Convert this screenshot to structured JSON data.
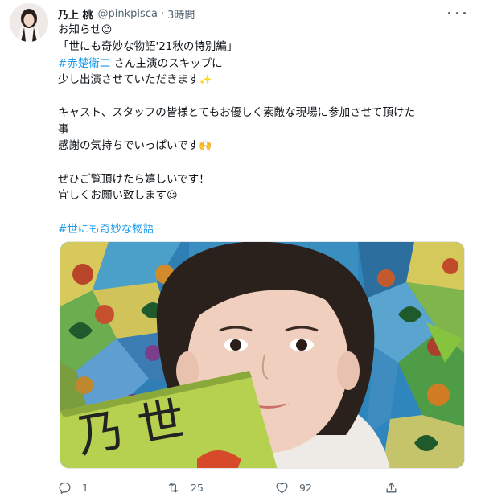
{
  "user": {
    "display_name": "乃上 桃",
    "handle": "@pinkpisca",
    "separator": "·",
    "time": "3時間"
  },
  "tweet": {
    "lines": [
      [
        {
          "t": "お知らせ"
        },
        {
          "e": "☺"
        }
      ],
      [
        {
          "t": "「世にも奇妙な物語'21秋の特別編」"
        }
      ],
      [
        {
          "l": "#赤楚衛二"
        },
        {
          "t": " さん主演のスキップに"
        }
      ],
      [
        {
          "t": "少し出演させていただきます"
        },
        {
          "e": "✨"
        }
      ],
      [],
      [
        {
          "t": "キャスト、スタッフの皆様とてもお優しく素敵な現場に参加させて頂けた"
        }
      ],
      [
        {
          "t": "事"
        }
      ],
      [
        {
          "t": "感謝の気持ちでいっぱいです"
        },
        {
          "e": "🙌"
        }
      ],
      [],
      [
        {
          "t": "ぜひご覧頂けたら嬉しいです！"
        }
      ],
      [
        {
          "t": "宜しくお願い致します"
        },
        {
          "e": "☺"
        }
      ],
      [],
      [
        {
          "l": "#世にも奇妙な物語"
        }
      ]
    ]
  },
  "media": {
    "sign_text": "乃 世"
  },
  "actions": {
    "reply_count": "1",
    "retweet_count": "25",
    "like_count": "92"
  },
  "colors": {
    "link": "#1d9bf0",
    "meta": "#536471",
    "text": "#0f1419"
  }
}
